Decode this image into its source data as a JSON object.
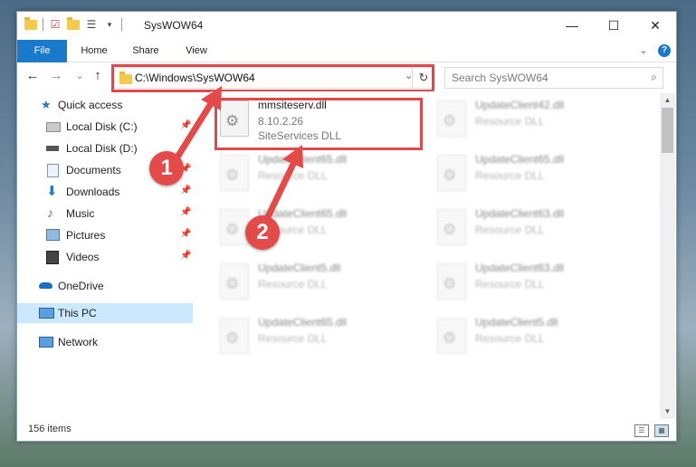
{
  "window": {
    "title": "SysWOW64",
    "controls": {
      "minimize": "—",
      "maximize": "☐",
      "close": "✕"
    }
  },
  "ribbon": {
    "tabs": [
      "File",
      "Home",
      "Share",
      "View"
    ],
    "expand_icon": "⌄",
    "help_icon": "?"
  },
  "navigation": {
    "back": "←",
    "forward": "→",
    "recent": "⌄",
    "up": "↑",
    "address": "C:\\Windows\\SysWOW64",
    "address_dropdown": "⌄",
    "refresh": "↻",
    "search_placeholder": "Search SysWOW64",
    "search_icon": "⌕"
  },
  "sidebar": {
    "items": [
      {
        "label": "Quick access",
        "icon": "star-icon"
      },
      {
        "label": "Local Disk (C:)",
        "icon": "drive-icon",
        "pinned": true
      },
      {
        "label": "Local Disk (D:)",
        "icon": "drive-icon",
        "pinned": false
      },
      {
        "label": "Documents",
        "icon": "documents-icon",
        "pinned": true
      },
      {
        "label": "Downloads",
        "icon": "downloads-icon",
        "pinned": true
      },
      {
        "label": "Music",
        "icon": "music-icon",
        "pinned": true
      },
      {
        "label": "Pictures",
        "icon": "pictures-icon",
        "pinned": true
      },
      {
        "label": "Videos",
        "icon": "videos-icon",
        "pinned": true
      },
      {
        "label": "OneDrive",
        "icon": "onedrive-icon"
      },
      {
        "label": "This PC",
        "icon": "pc-icon",
        "selected": true
      },
      {
        "label": "Network",
        "icon": "network-icon"
      }
    ],
    "pin_glyph": "📌"
  },
  "files": [
    {
      "name": "mmsiteserv.dll",
      "line2": "8.10.2.26",
      "line3": "SiteServices DLL"
    },
    {
      "name": "UpdateClient42.dll",
      "line2": "Resource DLL",
      "line3": ""
    },
    {
      "name": "UpdateClient65.dll",
      "line2": "Resource DLL",
      "line3": ""
    },
    {
      "name": "UpdateClient65.dll",
      "line2": "Resource DLL",
      "line3": ""
    },
    {
      "name": "UpdateClient65.dll",
      "line2": "Resource DLL",
      "line3": ""
    },
    {
      "name": "UpdateClient63.dll",
      "line2": "Resource DLL",
      "line3": ""
    },
    {
      "name": "UpdateClient5.dll",
      "line2": "Resource DLL",
      "line3": ""
    },
    {
      "name": "UpdateClient63.dll",
      "line2": "Resource DLL",
      "line3": ""
    },
    {
      "name": "UpdateClient65.dll",
      "line2": "Resource DLL",
      "line3": ""
    },
    {
      "name": "UpdateClient5.dll",
      "line2": "Resource DLL",
      "line3": ""
    }
  ],
  "status": {
    "item_count": "156 items"
  },
  "callouts": [
    "1",
    "2"
  ],
  "colors": {
    "accent": "#1979ca",
    "highlight": "#e0484b",
    "selected_bg": "#cce8ff",
    "callout": "#e34b4b"
  }
}
